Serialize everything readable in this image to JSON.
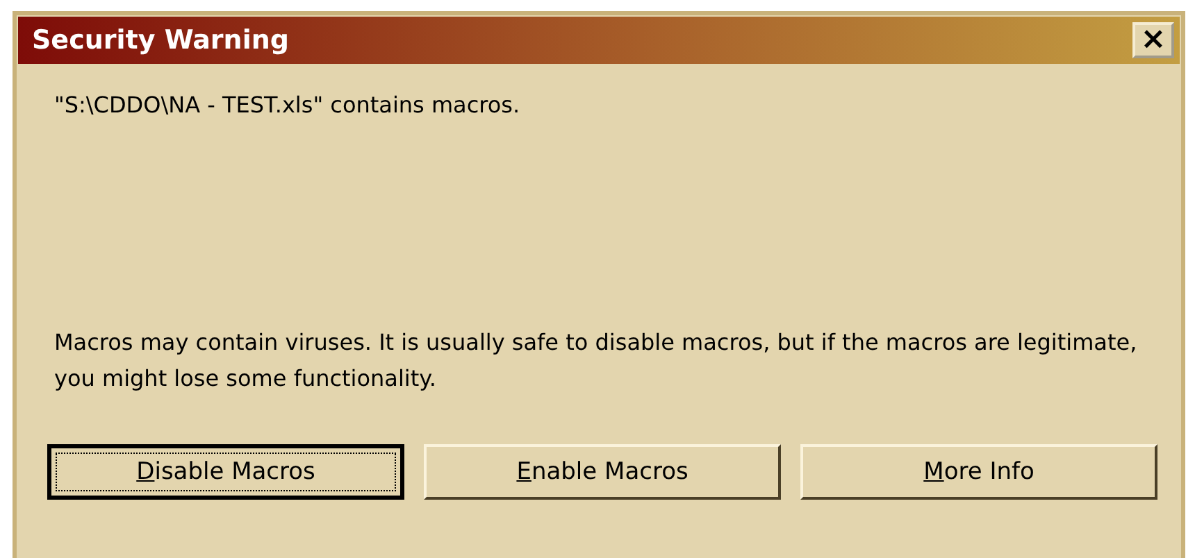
{
  "window": {
    "title": "Security Warning",
    "close": "×"
  },
  "message": "\"S:\\CDDO\\NA - TEST.xls\" contains macros.",
  "warning": "Macros may contain viruses. It is usually safe to disable macros, but if the macros are legitimate, you might lose some functionality.",
  "buttons": [
    {
      "accel": "D",
      "rest": "isable Macros",
      "focused": true
    },
    {
      "accel": "E",
      "rest": "nable Macros",
      "focused": false
    },
    {
      "accel": "M",
      "rest": "ore Info",
      "focused": false
    }
  ]
}
